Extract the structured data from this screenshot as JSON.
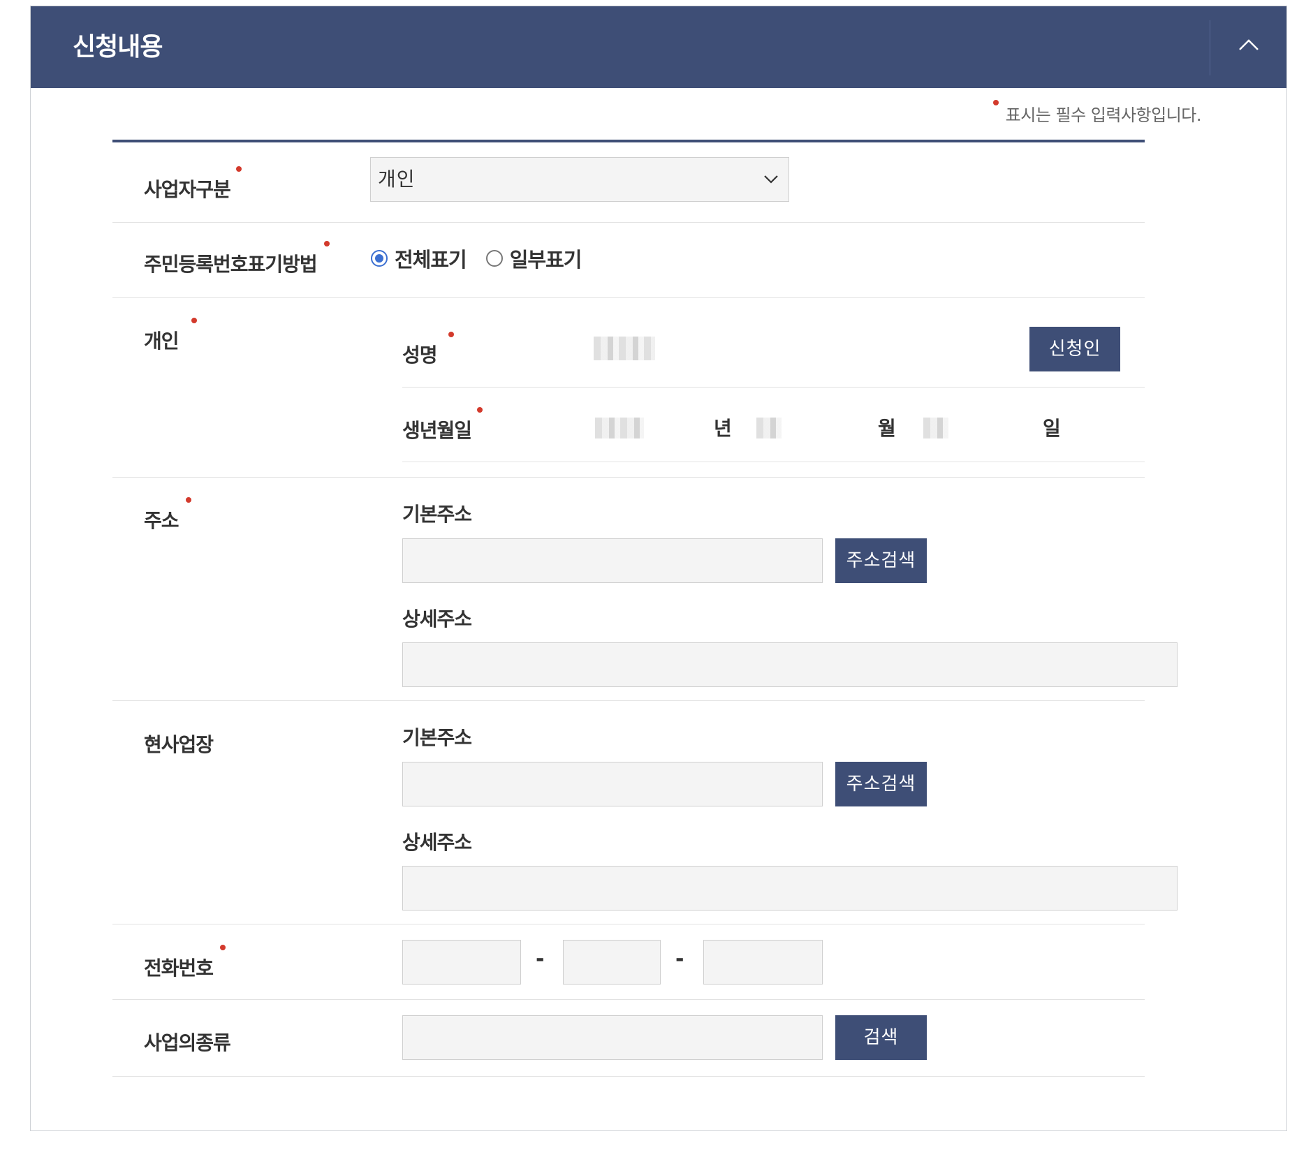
{
  "header": {
    "title": "신청내용",
    "collapse_icon": "chevron-up-icon"
  },
  "required_note": "표시는 필수 입력사항입니다.",
  "business_type": {
    "label": "사업자구분",
    "selected": "개인"
  },
  "rrn_display": {
    "label": "주민등록번호표기방법",
    "options": [
      {
        "label": "전체표기",
        "checked": true
      },
      {
        "label": "일부표기",
        "checked": false
      }
    ]
  },
  "individual": {
    "label": "개인",
    "name_label": "성명",
    "applicant_button": "신청인",
    "birth_label": "생년월일",
    "year_unit": "년",
    "month_unit": "월",
    "day_unit": "일"
  },
  "address": {
    "label": "주소",
    "basic_label": "기본주소",
    "search_button": "주소검색",
    "detail_label": "상세주소"
  },
  "business_site": {
    "label": "현사업장",
    "basic_label": "기본주소",
    "search_button": "주소검색",
    "detail_label": "상세주소"
  },
  "phone": {
    "label": "전화번호",
    "separator": "-"
  },
  "business_kind": {
    "label": "사업의종류",
    "search_button": "검색"
  },
  "colors": {
    "header_bg": "#3e4e76",
    "button_bg": "#3e4e76",
    "required_dot": "#d33a2c",
    "radio_checked": "#3b6fd1"
  }
}
